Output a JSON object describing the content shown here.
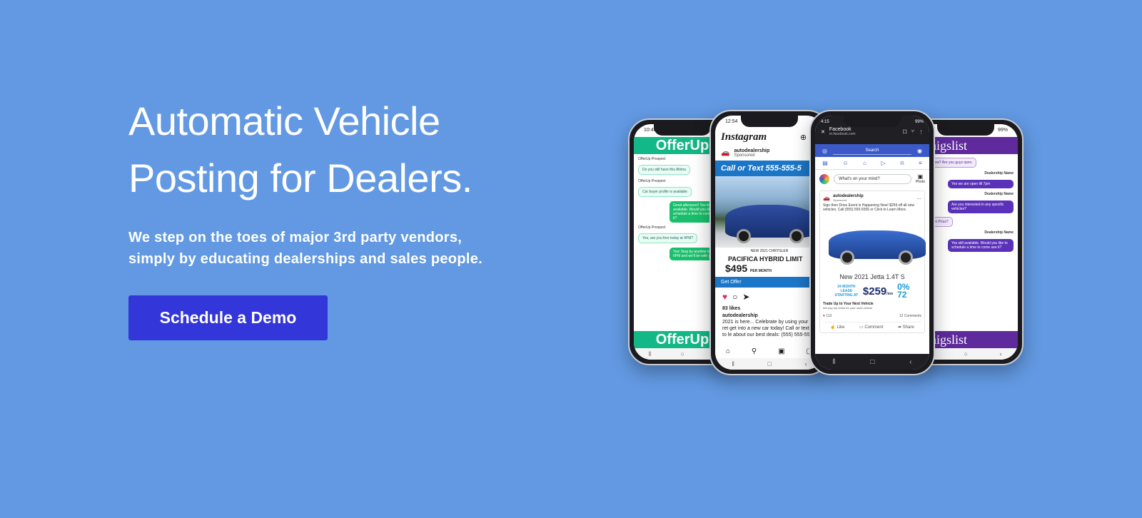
{
  "hero": {
    "title_line1": "Automatic Vehicle",
    "title_line2": "Posting for Dealers.",
    "subtitle_line1": "We step on the toes of major 3rd party vendors,",
    "subtitle_line2": "simply by educating dealerships and sales people.",
    "cta_label": "Schedule a Demo"
  },
  "colors": {
    "background": "#6299e2",
    "cta": "#3336d8",
    "offerup": "#12b886",
    "craigslist": "#5e2a9c",
    "facebook": "#3b5ac8",
    "instagram_ad": "#1c76c7"
  },
  "phones": {
    "offerup": {
      "time": "10:46",
      "brand": "OfferUp",
      "messages": [
        {
          "from": "OfferUp Prospect",
          "text": "Do you still have this Altima"
        },
        {
          "from": "OfferUp Prospect",
          "text": "Car buyer profile is available"
        },
        {
          "from": "",
          "text": "Good afternoon! Yes this is still available. Would you like to schedule a time to come see it?"
        },
        {
          "from": "OfferUp Prospect",
          "text": "Yes, are you free today at 4PM?"
        },
        {
          "from": "",
          "text": "Yes! Stop by anytime before 6PM and we'll be with you!"
        }
      ],
      "footer": "OfferUp"
    },
    "instagram": {
      "time": "12:54",
      "logo": "Instagram",
      "account": "autodealership",
      "sponsored": "Sponsored",
      "ad_headline": "Call or Text 555-555-5",
      "model": "PACIFICA HYBRID LIMIT",
      "model_year": "NEW 2021 CHRYSLER",
      "price": "$495",
      "price_note": "PER MONTH",
      "offer_button": "Get Offer",
      "likes": "83 likes",
      "caption_author": "autodealership",
      "caption": "2021 is here... Celebrate by using your tax ret get into a new car today! Call or text us to le about our best deals: (555) 555-5555"
    },
    "facebook": {
      "time": "4:15",
      "battery": "99%",
      "page_title": "Facebook",
      "url": "m.facebook.com",
      "search_placeholder": "Search",
      "mind_prompt": "What's on your mind?",
      "photo_label": "Photo",
      "post_author": "autodealership",
      "post_sponsored": "Sponsored",
      "post_text": "Sign then Drive Event is Happening Now! $259 off all new vehicles. Call (555) 555-5555 or Click to Learn More.",
      "car_model": "New 2021 Jetta 1.4T S",
      "lease_label": "24 MONTH LEASE STARTING AT",
      "lease_price": "$259",
      "lease_per": "/mo",
      "apr": "0% 72",
      "trade_title": "Trade Up to Your Next Vehicle",
      "trade_sub": "We pay top dollar for your used vehicle",
      "reactions": "113",
      "comments": "12 Comments",
      "like": "Like",
      "comment": "Comment",
      "share": "Share"
    },
    "craigslist": {
      "battery": "99%",
      "brand": "craigslist",
      "messages": [
        {
          "side": "left",
          "text": "Any yellow? Are you guys open"
        },
        {
          "side": "right",
          "name": "Dealership Name",
          "text": "Yes we are open till 7pm"
        },
        {
          "side": "right",
          "name": "Dealership Name",
          "text": "Are you interested in any specific vehicles?"
        },
        {
          "side": "left",
          "text": "the green Prius?"
        },
        {
          "side": "left",
          "text": ""
        },
        {
          "side": "right",
          "name": "Dealership Name",
          "text": "Yes still available. Would you like to schedule a time to come see it?"
        }
      ],
      "footer": "craigslist"
    }
  }
}
